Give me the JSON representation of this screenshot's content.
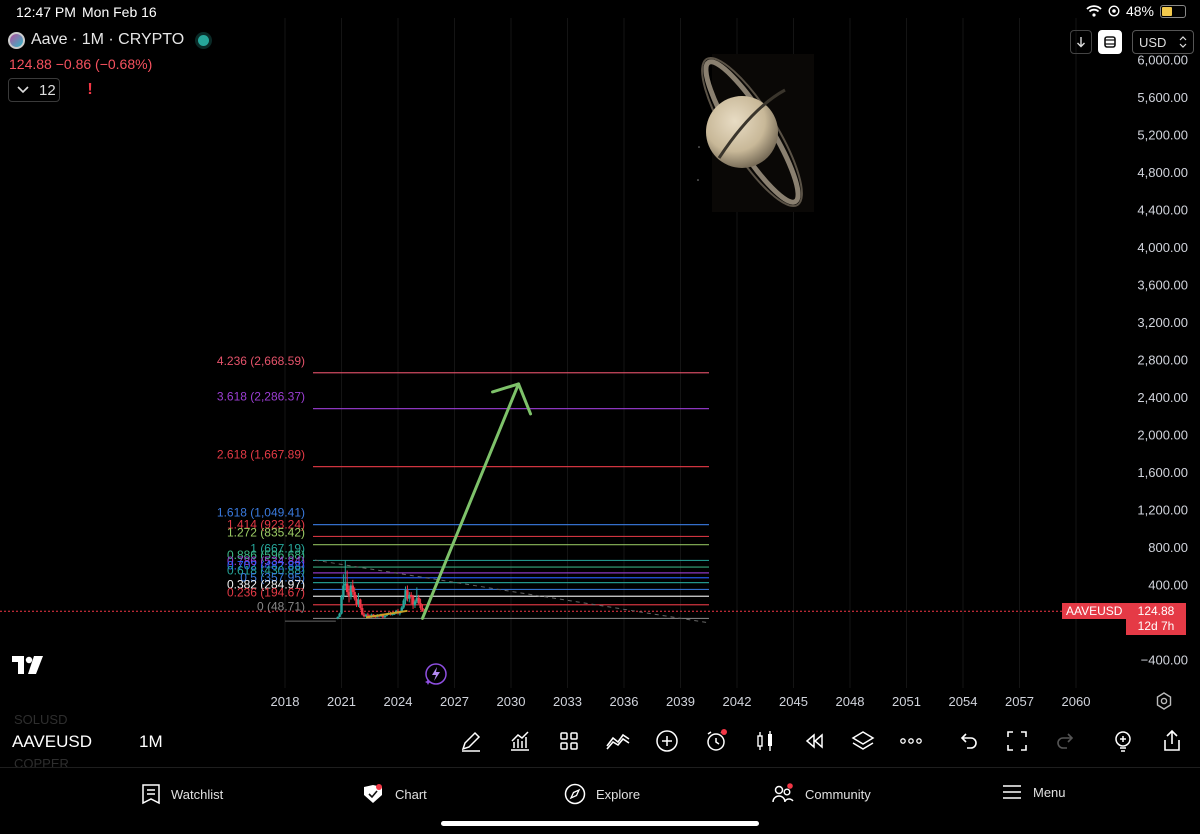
{
  "status_bar": {
    "time": "12:47 PM",
    "date": "Mon Feb 16",
    "battery": "48%",
    "battery_level": 0.48
  },
  "header": {
    "symbol_title": "Aave · 1M · CRYPTO",
    "last_price": "124.88",
    "change": "−0.86 (−0.68%)",
    "indicator_count": "12",
    "alert_symbol": "!",
    "currency": "USD"
  },
  "price_axis": {
    "labels": [
      "6,000.00",
      "5,600.00",
      "5,200.00",
      "4,800.00",
      "4,400.00",
      "4,000.00",
      "3,600.00",
      "3,200.00",
      "2,800.00",
      "2,400.00",
      "2,000.00",
      "1,600.00",
      "1,200.00",
      "800.00",
      "400.00",
      "−400.00"
    ],
    "current_symbol": "AAVEUSD",
    "current_price": "124.88",
    "countdown": "12d 7h"
  },
  "time_axis": {
    "labels": [
      "2018",
      "2021",
      "2024",
      "2027",
      "2030",
      "2033",
      "2036",
      "2039",
      "2042",
      "2045",
      "2048",
      "2051",
      "2054",
      "2057",
      "2060"
    ]
  },
  "fib_levels": [
    {
      "label": "4.236 (2,668.59)",
      "price": 2668.59,
      "color": "#e5536b"
    },
    {
      "label": "3.618 (2,286.37)",
      "price": 2286.37,
      "color": "#9c3ed4"
    },
    {
      "label": "2.618 (1,667.89)",
      "price": 1667.89,
      "color": "#e53a46"
    },
    {
      "label": "1.618 (1,049.41)",
      "price": 1049.41,
      "color": "#3a7be0"
    },
    {
      "label": "1.414 (923.24)",
      "price": 923.24,
      "color": "#e53a46"
    },
    {
      "label": "1.272 (835.42)",
      "price": 835.42,
      "color": "#9ccc65"
    },
    {
      "label": "1 (667.19)",
      "price": 667.19,
      "color": "#26a69a"
    },
    {
      "label": "0.886 (596.68)",
      "price": 596.68,
      "color": "#3dbb8a"
    },
    {
      "label": "0.786 (534.84)",
      "price": 534.84,
      "color": "#9c3ed4"
    },
    {
      "label": "0.702 (482.88)",
      "price": 482.88,
      "color": "#2962ff"
    },
    {
      "label": "0.618 (430.88)",
      "price": 430.88,
      "color": "#26a69a"
    },
    {
      "label": "0.5 (357.95)",
      "price": 357.95,
      "color": "#3a7be0"
    },
    {
      "label": "0.382 (284.97)",
      "price": 284.97,
      "color": "#f0f0f0"
    },
    {
      "label": "0.236 (194.67)",
      "price": 194.67,
      "color": "#e53a46"
    },
    {
      "label": "0 (48.71)",
      "price": 48.71,
      "color": "#888888"
    }
  ],
  "toolbar": {
    "symbol": "AAVEUSD",
    "symbol_prev": "SOLUSD",
    "symbol_next": "COPPER",
    "interval": "1M"
  },
  "nav": {
    "watchlist": "Watchlist",
    "chart": "Chart",
    "explore": "Explore",
    "community": "Community",
    "menu": "Menu"
  },
  "colors": {
    "up": "#26a69a",
    "down": "#f23645",
    "arrow": "#7ec26a",
    "projection": "#c9a227"
  }
}
